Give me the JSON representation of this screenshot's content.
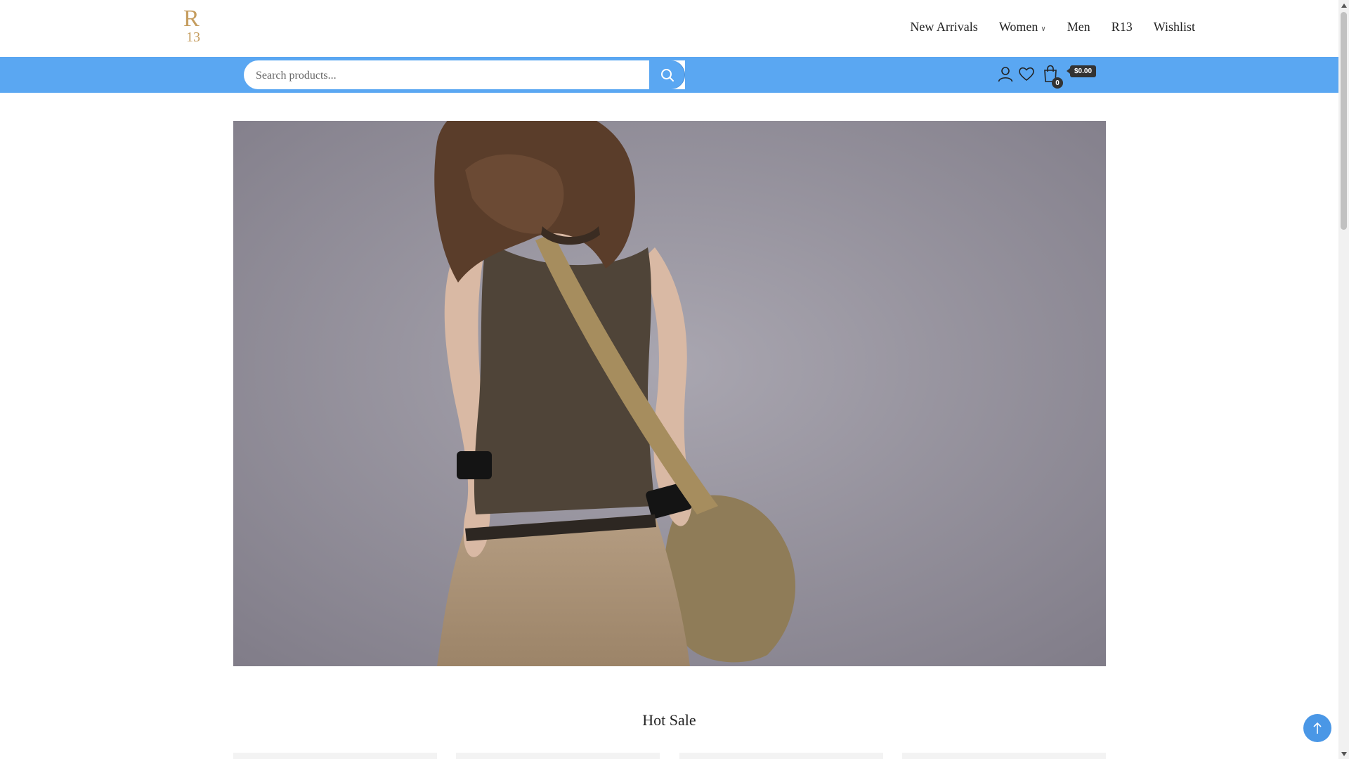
{
  "header": {
    "logo_line1": "R",
    "logo_line2": "13",
    "nav": [
      {
        "label": "New Arrivals"
      },
      {
        "label": "Women"
      },
      {
        "label": "Men"
      },
      {
        "label": "R13"
      },
      {
        "label": "Wishlist"
      }
    ]
  },
  "toolbar": {
    "search_placeholder": "Search products...",
    "cart_count": "0",
    "cart_total": "$0.00"
  },
  "hero": {
    "icon": "hero-model-photo"
  },
  "sections": {
    "hot_sale_title": "Hot Sale"
  },
  "colors": {
    "accent_blue": "#5aa7f2",
    "logo_gold": "#c59d5f"
  }
}
